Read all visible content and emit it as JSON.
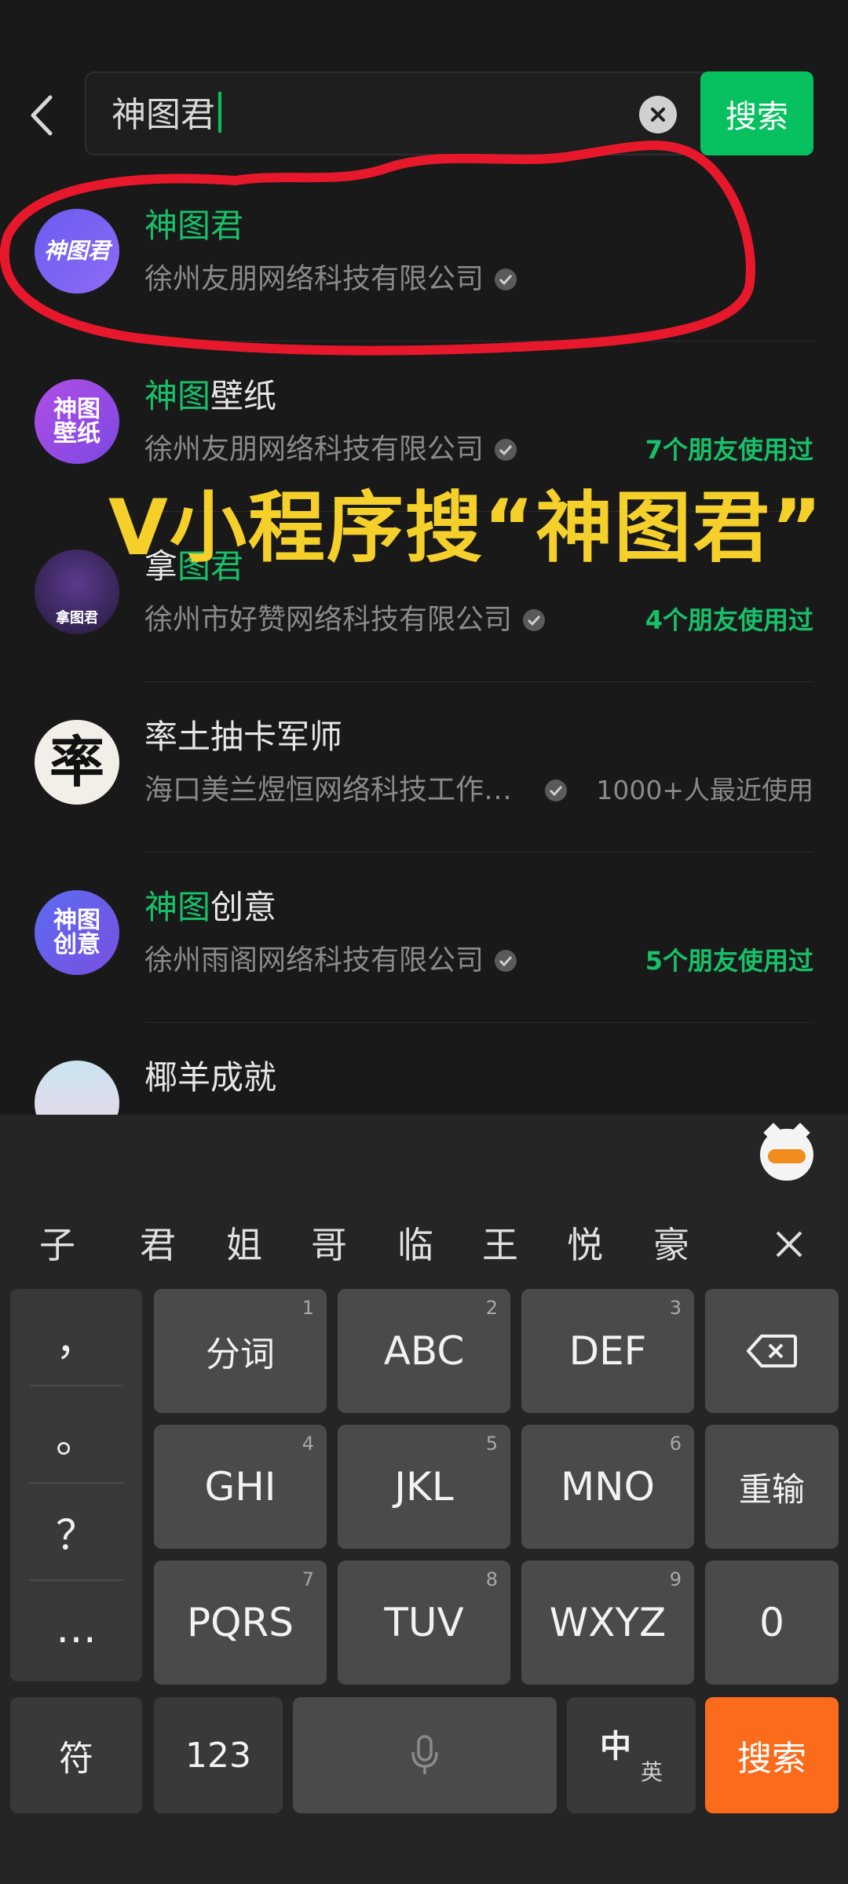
{
  "search": {
    "query": "神图君",
    "button_label": "搜索"
  },
  "results": [
    {
      "title_highlight": "神图君",
      "title_rest": "",
      "company": "徐州友朋网络科技有限公司",
      "meta": "",
      "avatar_text": "神图君"
    },
    {
      "title_highlight": "神图",
      "title_rest": "壁纸",
      "company": "徐州友朋网络科技有限公司",
      "meta": "7个朋友使用过",
      "avatar_text": "神图壁纸"
    },
    {
      "title_highlight": "",
      "title_prefix": "拿",
      "title_rest": "图君",
      "company": "徐州市好赞网络科技有限公司",
      "meta": "4个朋友使用过",
      "avatar_text": "拿图君"
    },
    {
      "title_highlight": "",
      "title_rest": "率土抽卡军师",
      "company": "海口美兰煜恒网络科技工作…",
      "meta": "1000+人最近使用",
      "avatar_text": "率"
    },
    {
      "title_highlight": "神图",
      "title_rest": "创意",
      "company": "徐州雨阁网络科技有限公司",
      "meta": "5个朋友使用过",
      "avatar_text": "神图创意"
    },
    {
      "title_highlight": "",
      "title_rest": "椰羊成就",
      "company": "",
      "meta": "",
      "avatar_text": ""
    }
  ],
  "overlay": {
    "text": "V小程序搜“神图君”"
  },
  "keyboard": {
    "candidates": [
      "子",
      "君",
      "姐",
      "哥",
      "临",
      "王",
      "悦",
      "豪"
    ],
    "punctuation": [
      "，",
      "。",
      "？",
      "…"
    ],
    "keys": [
      {
        "label": "分词",
        "num": "1"
      },
      {
        "label": "ABC",
        "num": "2"
      },
      {
        "label": "DEF",
        "num": "3"
      },
      {
        "label": "GHI",
        "num": "4"
      },
      {
        "label": "JKL",
        "num": "5"
      },
      {
        "label": "MNO",
        "num": "6"
      },
      {
        "label": "PQRS",
        "num": "7"
      },
      {
        "label": "TUV",
        "num": "8"
      },
      {
        "label": "WXYZ",
        "num": "9"
      }
    ],
    "reinput_label": "重输",
    "zero_label": "0",
    "symbol_label": "符",
    "numeric_label": "123",
    "zh_label": "中",
    "en_label": "英",
    "search_label": "搜索"
  },
  "colors": {
    "accent_green": "#07c160",
    "highlight_green": "#18c06a",
    "overlay_yellow": "#f5d02a",
    "annotation_red": "#e8182c",
    "search_key_orange": "#fa6b1c"
  }
}
